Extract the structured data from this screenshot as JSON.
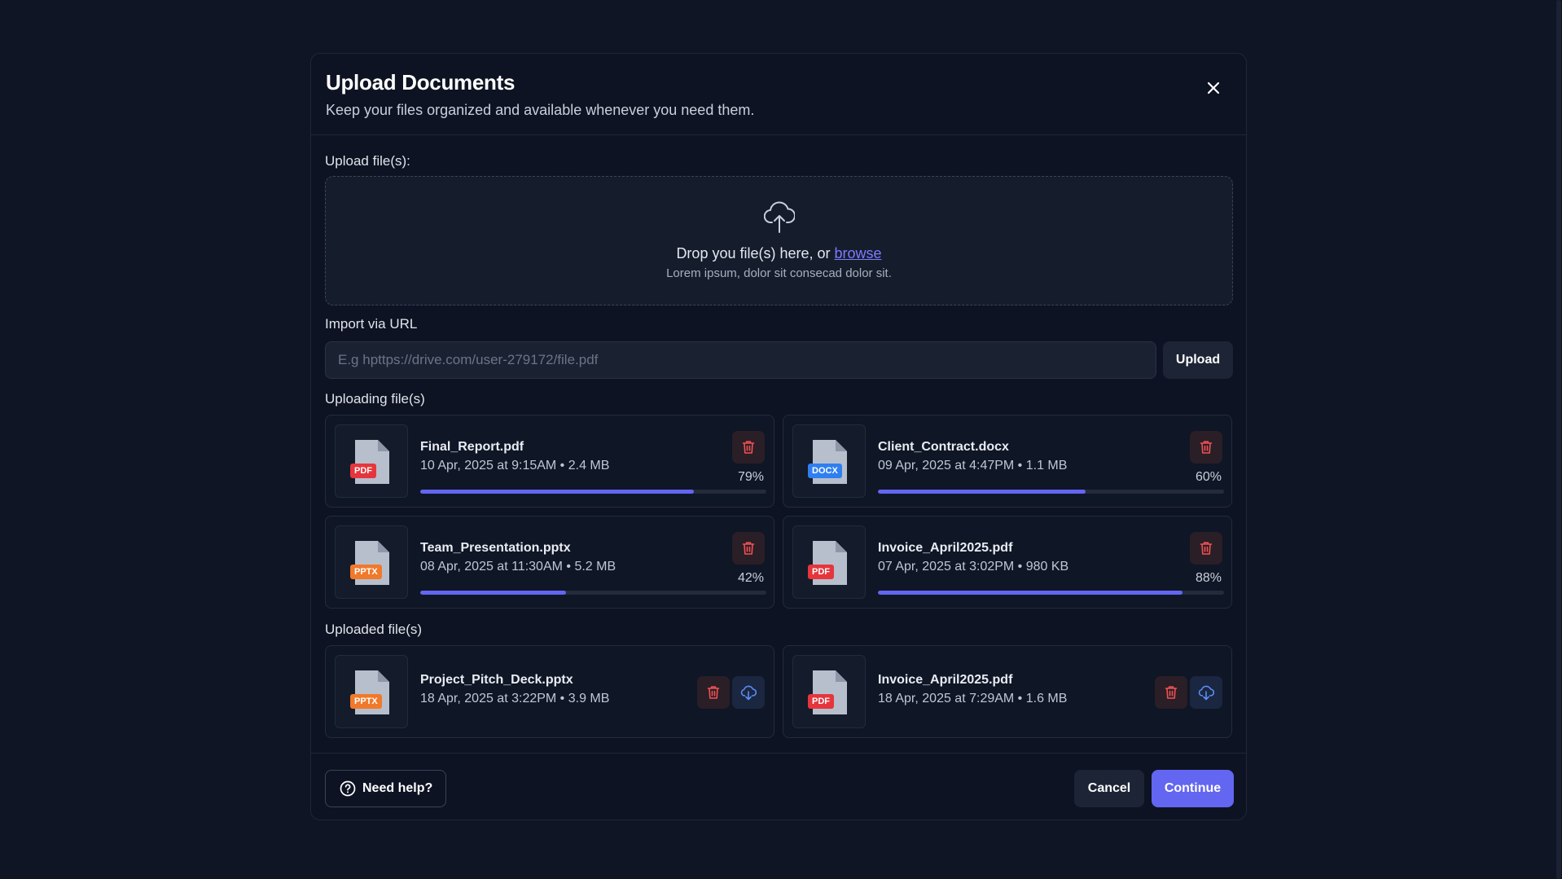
{
  "modal": {
    "title": "Upload Documents",
    "subtitle": "Keep your files organized and available whenever you need them.",
    "close_icon": "close-icon"
  },
  "dropzone": {
    "label": "Upload file(s):",
    "text": "Drop you file(s) here, or ",
    "browse_label": "browse",
    "subtext": "Lorem ipsum, dolor sit consecad dolor sit.",
    "icon": "cloud-upload-icon"
  },
  "url_import": {
    "label": "Import via URL",
    "placeholder": "E.g hpttps://drive.com/user-279172/file.pdf",
    "value": "",
    "button_label": "Upload"
  },
  "uploading": {
    "label": "Uploading file(s)",
    "files": [
      {
        "name": "Final_Report.pdf",
        "meta": "10 Apr, 2025 at 9:15AM • 2.4 MB",
        "ext": "PDF",
        "progress": 0.79,
        "progress_label": "79%"
      },
      {
        "name": "Client_Contract.docx",
        "meta": "09 Apr, 2025 at 4:47PM • 1.1 MB",
        "ext": "DOCX",
        "progress": 0.6,
        "progress_label": "60%"
      },
      {
        "name": "Team_Presentation.pptx",
        "meta": "08 Apr, 2025 at 11:30AM • 5.2 MB",
        "ext": "PPTX",
        "progress": 0.42,
        "progress_label": "42%"
      },
      {
        "name": "Invoice_April2025.pdf",
        "meta": "07 Apr, 2025 at 3:02PM • 980 KB",
        "ext": "PDF",
        "progress": 0.88,
        "progress_label": "88%"
      }
    ]
  },
  "uploaded": {
    "label": "Uploaded file(s)",
    "files": [
      {
        "name": "Project_Pitch_Deck.pptx",
        "meta": "18 Apr, 2025 at 3:22PM • 3.9 MB",
        "ext": "PPTX"
      },
      {
        "name": "Invoice_April2025.pdf",
        "meta": "18 Apr, 2025 at 7:29AM • 1.6 MB",
        "ext": "PDF"
      }
    ]
  },
  "footer": {
    "help_label": "Need help?",
    "cancel_label": "Cancel",
    "continue_label": "Continue"
  },
  "colors": {
    "accent": "#6366f1",
    "pdf": "#e5363d",
    "docx": "#2f7ff0",
    "pptx": "#f0792b",
    "delete": "#f05252",
    "download": "#5b8ef5"
  }
}
